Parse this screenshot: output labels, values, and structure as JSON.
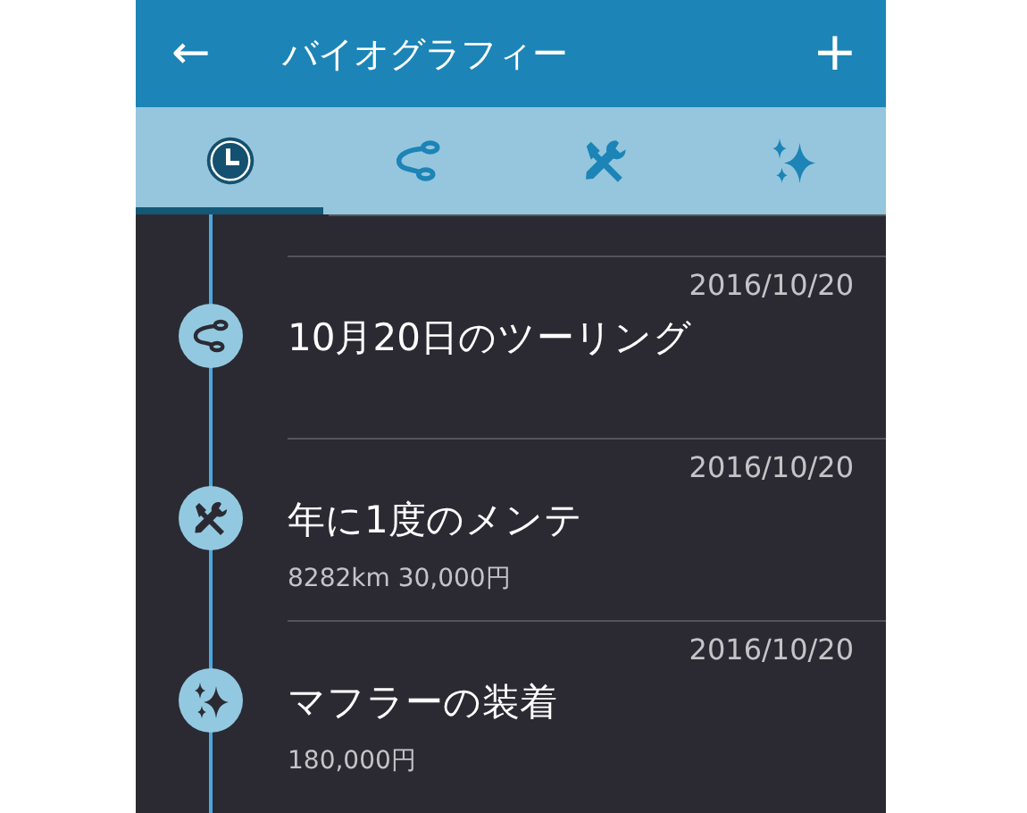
{
  "app_bar": {
    "back": "←",
    "title": "バイオグラフィー",
    "add": "+"
  },
  "tabs": [
    {
      "kind": "timeline",
      "selected": true
    },
    {
      "kind": "touring",
      "selected": false
    },
    {
      "kind": "maintenance",
      "selected": false
    },
    {
      "kind": "custom",
      "selected": false
    }
  ],
  "entries": [
    {
      "kind": "touring",
      "date": "2016/10/20",
      "title": "10月20日のツーリング"
    },
    {
      "kind": "maintenance",
      "date": "2016/10/20",
      "title": "年に1度のメンテ",
      "detail": "8282km 30,000円"
    },
    {
      "kind": "custom",
      "date": "2016/10/20",
      "title": "マフラーの装着",
      "detail": "180,000円"
    }
  ]
}
